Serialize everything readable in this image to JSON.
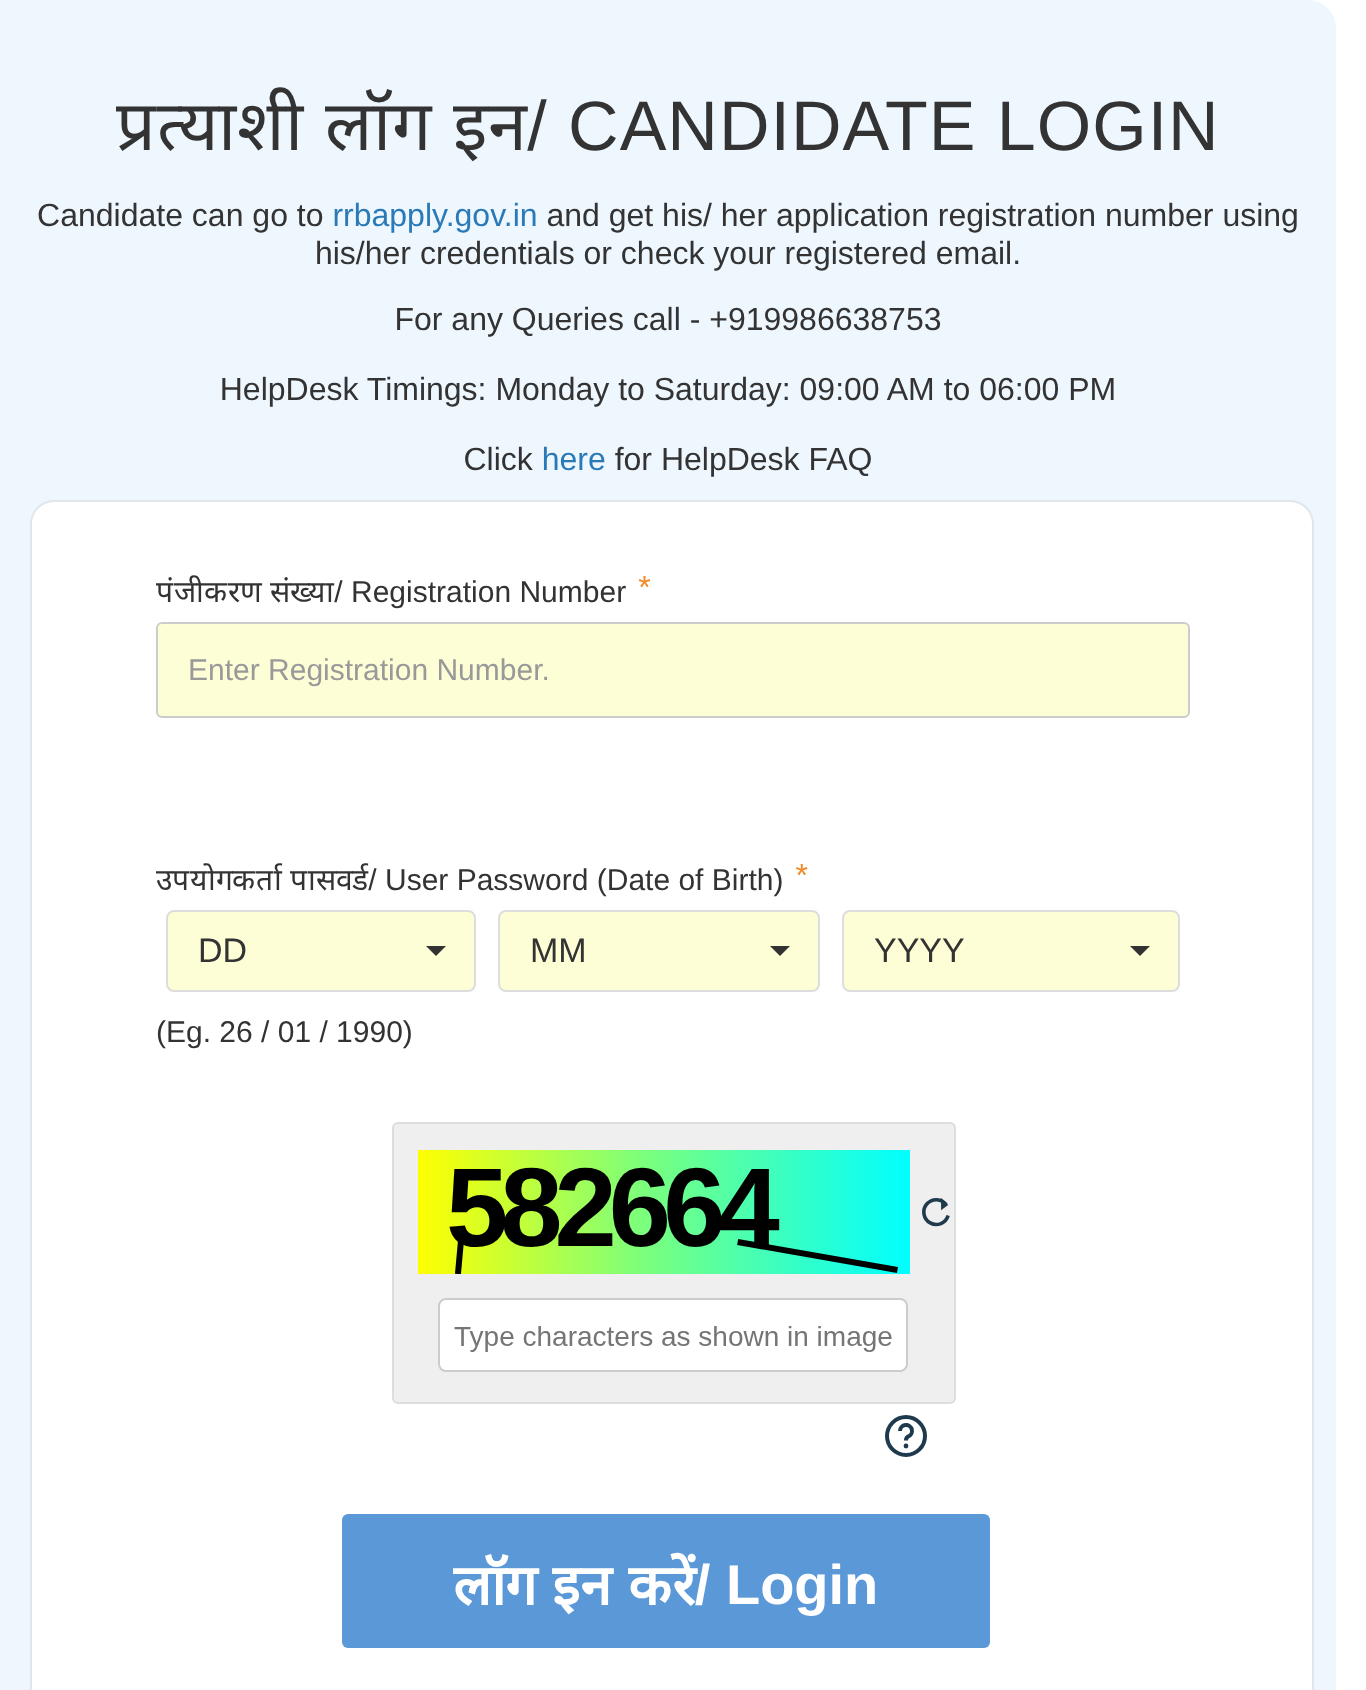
{
  "title": "प्रत्याशी लॉग इन/ CANDIDATE LOGIN",
  "info": {
    "before": "Candidate can go to",
    "link": "rrbapply.gov.in",
    "after": "and get his/ her application registration number using his/her credentials or check your registered email."
  },
  "queries": "For any Queries call - +919986638753",
  "timings": "HelpDesk Timings: Monday to Saturday: 09:00 AM to 06:00 PM",
  "faq": {
    "before": "Click",
    "link": "here",
    "after": "for HelpDesk FAQ"
  },
  "registration": {
    "label": "पंजीकरण संख्या/ Registration Number",
    "required_mark": "*",
    "placeholder": "Enter Registration Number."
  },
  "password": {
    "label": "उपयोगकर्ता पासवर्ड/ User Password (Date of Birth)",
    "required_mark": "*",
    "selects": [
      {
        "value": "DD"
      },
      {
        "value": "MM"
      },
      {
        "value": "YYYY"
      }
    ],
    "hint": "(Eg. 26 / 01 / 1990)"
  },
  "captcha": {
    "code": "582664",
    "placeholder": "Type characters as shown in image"
  },
  "login_button": "लॉग इन करें/ Login"
}
